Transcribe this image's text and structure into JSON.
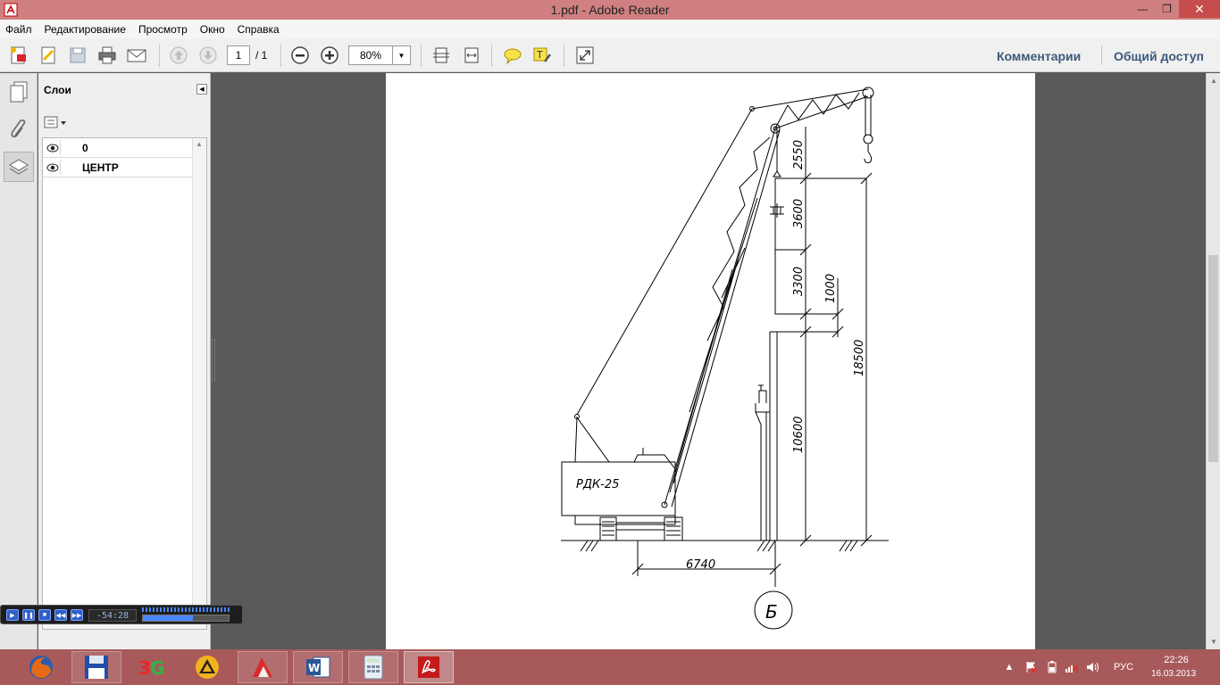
{
  "window": {
    "title": "1.pdf - Adobe Reader"
  },
  "menu": [
    "Файл",
    "Редактирование",
    "Просмотр",
    "Окно",
    "Справка"
  ],
  "toolbar": {
    "page_current": "1",
    "page_total": "/ 1",
    "zoom": "80%",
    "comments_label": "Комментарии",
    "share_label": "Общий доступ"
  },
  "layers_panel": {
    "title": "Слои",
    "layers": [
      {
        "name": "0"
      },
      {
        "name": "ЦЕНТР"
      }
    ]
  },
  "drawing": {
    "crane_label": "РДК-25",
    "dim_2550": "2550",
    "dim_3600": "3600",
    "dim_3300": "3300",
    "dim_1000": "1000",
    "dim_18500": "18500",
    "dim_10600": "10600",
    "dim_6740": "6740",
    "axis_label": "Б"
  },
  "media_player": {
    "time": "-54:28",
    "progress": 0.58
  },
  "tray": {
    "language": "РУС",
    "time": "22:26",
    "date": "16.03.2013"
  },
  "colors": {
    "titlebar": "#d08080",
    "taskbar": "#a85a5a",
    "close": "#c74c4c",
    "link": "#3c5a7a"
  }
}
